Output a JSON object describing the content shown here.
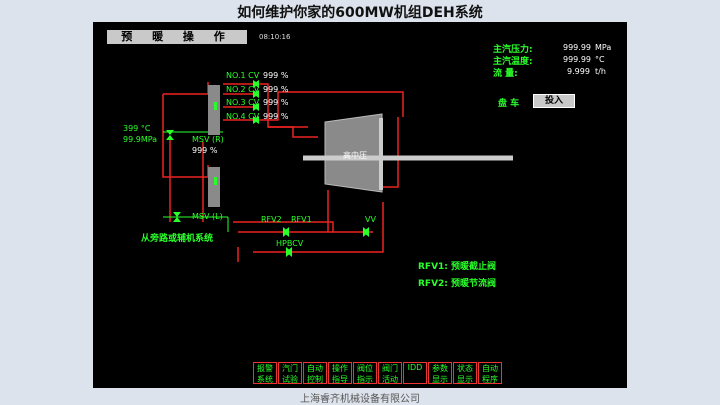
{
  "slide": {
    "title": "如何维护你家的600MW机组DEH系统",
    "footer": "上海睿齐机械设备有限公司"
  },
  "screen": {
    "header_title": "预 暖 操 作",
    "time": "08:10:16",
    "status": [
      {
        "label": "主汽压力:",
        "value": "999.99",
        "unit": "MPa"
      },
      {
        "label": "主汽温度:",
        "value": "999.99",
        "unit": "°C"
      },
      {
        "label": "流    量:",
        "value": "9.999",
        "unit": "t/h"
      }
    ],
    "turning": {
      "label": "盘 车",
      "value": "投入"
    },
    "inlet": {
      "temp": "399 °C",
      "pressure": "99.9MPa"
    },
    "valves_right": [
      {
        "name": "NO.1 CV",
        "value": "999 %"
      },
      {
        "name": "NO.2 CV",
        "value": "999 %"
      },
      {
        "name": "NO.3 CV",
        "value": "999 %"
      },
      {
        "name": "NO.4 CV",
        "value": "999 %"
      }
    ],
    "msv_r": {
      "name": "MSV (R)",
      "value": "999 %"
    },
    "msv_l": "MSV (L)",
    "turbine_label": "高中压",
    "rfv2": "RFV2",
    "rfv1": "RFV1",
    "vv": "VV",
    "hpbcv": "HPBCV",
    "bypass": "从旁路或辅机系统",
    "legend": [
      "RFV1: 预暖截止阀",
      "RFV2: 预暖节流阀"
    ],
    "bottom_buttons": [
      "报警系统",
      "汽门试验",
      "自动控制",
      "操作指导",
      "阀位指示",
      "阀门活动",
      "IDD",
      "参数显示",
      "状态显示",
      "自动程序"
    ]
  }
}
